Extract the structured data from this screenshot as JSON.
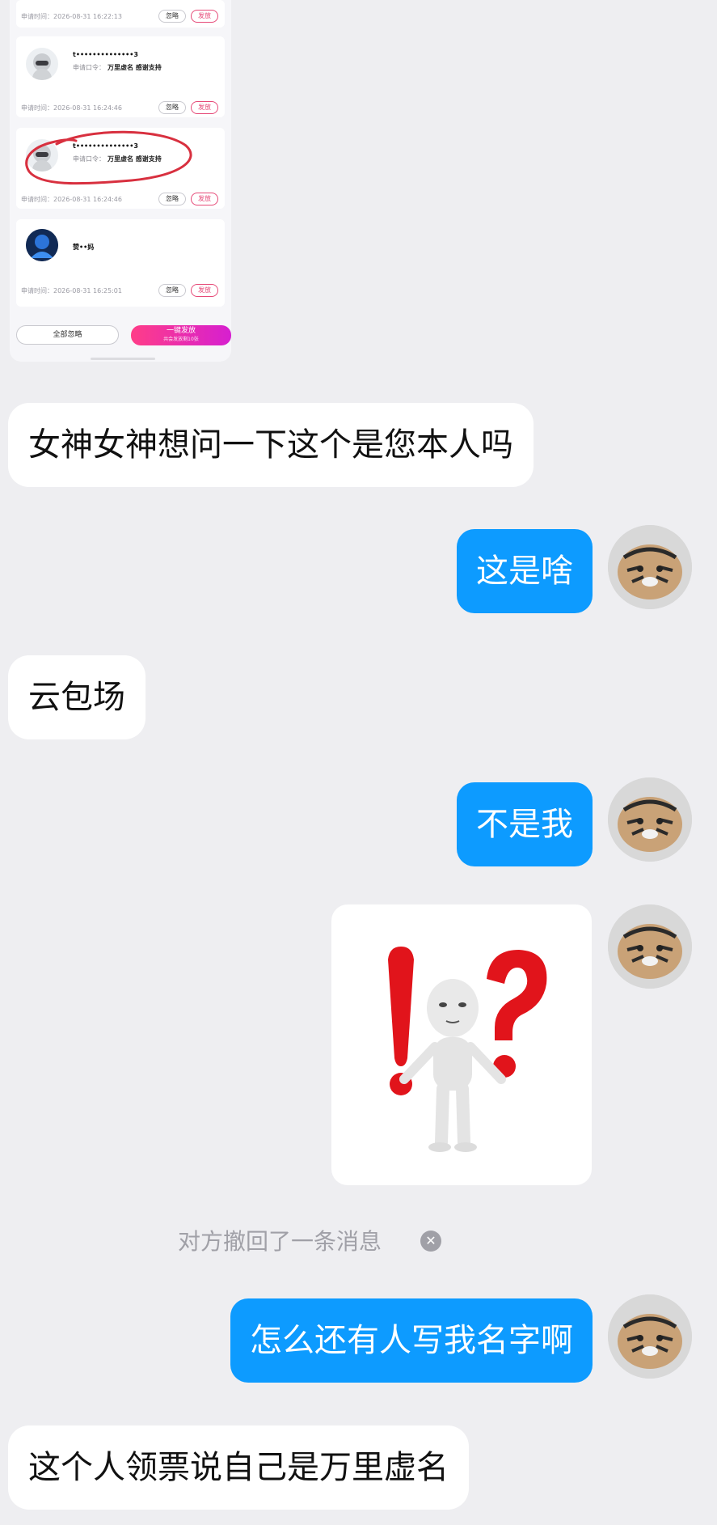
{
  "embedded": {
    "entries": [
      {
        "time": "申请时间：2026-08-31 16:22:13",
        "ignore": "忽略",
        "send": "发放"
      },
      {
        "name": "t••••••••••••••3",
        "cmd_prefix": "申请口令：",
        "cmd": "万里虚名 感谢支持",
        "time": "申请时间：2026-08-31 16:24:46",
        "ignore": "忽略",
        "send": "发放"
      },
      {
        "name": "t••••••••••••••3",
        "cmd_prefix": "申请口令：",
        "cmd": "万里虚名 感谢支持",
        "time": "申请时间：2026-08-31 16:24:46",
        "ignore": "忽略",
        "send": "发放"
      },
      {
        "name": "赞••妈",
        "time": "申请时间：2026-08-31 16:25:01",
        "ignore": "忽略",
        "send": "发放"
      }
    ],
    "ignore_all": "全部忽略",
    "send_all": "一键发放",
    "send_all_sub": "共会发放剩10张"
  },
  "messages": {
    "m1": "女神女神想问一下这个是您本人吗",
    "m2": "这是啥",
    "m3": "云包场",
    "m4": "不是我",
    "recall_notice": "对方撤回了一条消息",
    "m6": "怎么还有人写我名字啊",
    "m7": "这个人领票说自己是万里虚名"
  },
  "colors": {
    "own_bubble": "#0d9bff",
    "other_bubble": "#ffffff",
    "background": "#eeeef1",
    "annotation_red": "#d8303f"
  },
  "icons": {
    "recall_close": "close-circle-icon",
    "sticker": "exclamation-question-sticker"
  }
}
